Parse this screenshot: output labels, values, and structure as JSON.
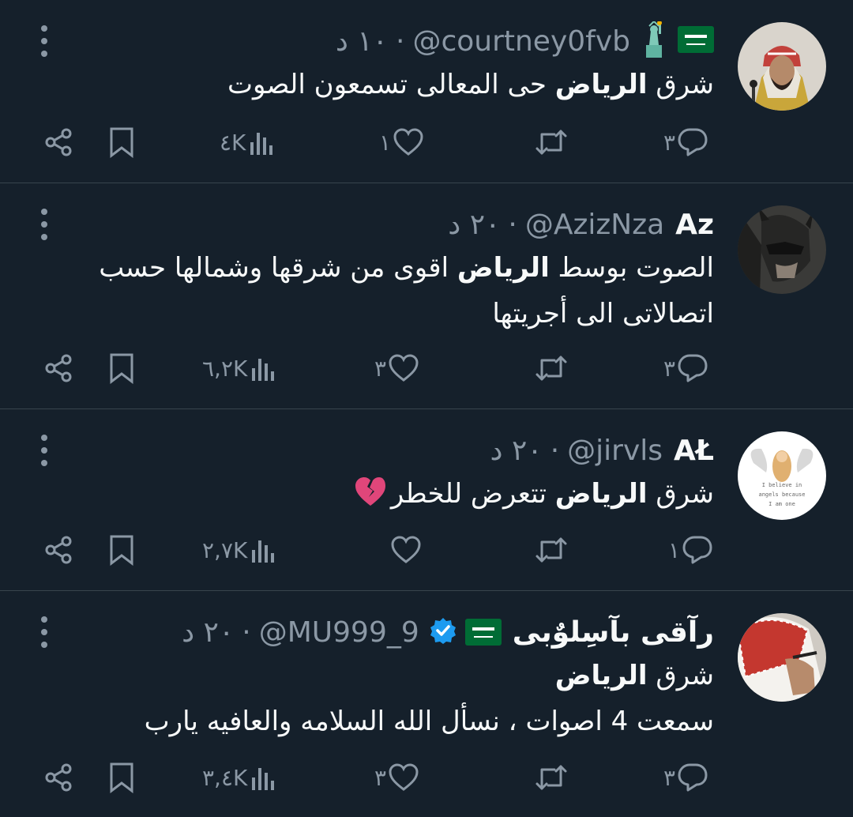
{
  "tweets": [
    {
      "name": "",
      "handle": "@courtney0fvb",
      "time": "١٠ د",
      "text_bold": "الرياض",
      "text_pre": "شرق ",
      "text_post": " حى المعالى تسمعون الصوت",
      "text_line2": "",
      "text_line3": "",
      "replies": "٣",
      "retweets": "",
      "likes": "١",
      "views": "٤K",
      "badges": [
        "saudi-flag",
        "statue-of-liberty"
      ]
    },
    {
      "name": "Az",
      "handle": "@AzizNza",
      "time": "٢٠ د",
      "text_pre": "الصوت بوسط ",
      "text_bold": "الرياض",
      "text_post": " اقوى من شرقها وشمالها حسب",
      "text_line2": "اتصالاتى الى أجريتها",
      "text_line3": "",
      "replies": "٣",
      "retweets": "",
      "likes": "٣",
      "views": "٦,٢K",
      "badges": []
    },
    {
      "name": "AŁ",
      "handle": "@jirvls",
      "time": "٢٠ د",
      "text_pre": "شرق ",
      "text_bold": "الرياض",
      "text_post": " تتعرض للخطر",
      "text_line2": "",
      "text_line3": "",
      "replies": "١",
      "retweets": "",
      "likes": "",
      "views": "٢,٧K",
      "badges": [],
      "avatar_text": [
        "I believe in",
        "angels because",
        "I am one"
      ]
    },
    {
      "name": "رآقى بآسِلوٌبى",
      "handle": "@MU999_9",
      "time": "٢٠ د",
      "text_pre": "شرق ",
      "text_bold": "الرياض",
      "text_post": "",
      "text_line2": "سمعت 4 اصوات ، نسأل الله السلامه والعافيه يارب",
      "text_line3": "",
      "replies": "٣",
      "retweets": "",
      "likes": "٣",
      "views": "٣,٤K",
      "badges": [
        "saudi-flag",
        "verified-badge"
      ]
    }
  ],
  "colors": {
    "background": "#15202b",
    "text": "#f7f9f9",
    "secondary": "#8b98a5",
    "divider": "#38444d",
    "verified": "#1d9bf0",
    "flag_green": "#006c35"
  }
}
